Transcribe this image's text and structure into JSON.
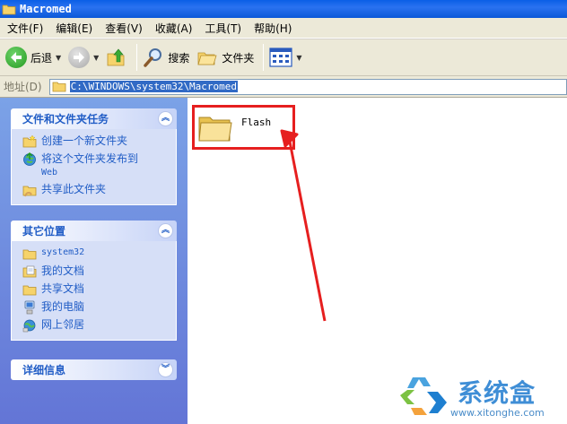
{
  "window": {
    "title": "Macromed"
  },
  "menu": [
    {
      "label": "文件(F)"
    },
    {
      "label": "编辑(E)"
    },
    {
      "label": "查看(V)"
    },
    {
      "label": "收藏(A)"
    },
    {
      "label": "工具(T)"
    },
    {
      "label": "帮助(H)"
    }
  ],
  "toolbar": {
    "back_label": "后退",
    "search_label": "搜索",
    "folders_label": "文件夹"
  },
  "address": {
    "label": "地址(D)",
    "value": "C:\\WINDOWS\\system32\\Macromed"
  },
  "tasks_panel": {
    "title": "文件和文件夹任务",
    "items": [
      {
        "label": "创建一个新文件夹",
        "icon": "new-folder-icon"
      },
      {
        "label": "将这个文件夹发布到",
        "label_line2": "Web",
        "icon": "publish-web-icon"
      },
      {
        "label": "共享此文件夹",
        "icon": "share-folder-icon"
      }
    ]
  },
  "places_panel": {
    "title": "其它位置",
    "items": [
      {
        "label": "system32",
        "icon": "folder-icon"
      },
      {
        "label": "我的文档",
        "icon": "my-documents-icon"
      },
      {
        "label": "共享文档",
        "icon": "shared-documents-icon"
      },
      {
        "label": "我的电脑",
        "icon": "my-computer-icon"
      },
      {
        "label": "网上邻居",
        "icon": "network-places-icon"
      }
    ]
  },
  "details_panel": {
    "title": "详细信息"
  },
  "files": [
    {
      "name": "Flash",
      "icon": "folder-icon"
    }
  ],
  "watermark": {
    "name": "系统盒",
    "url": "www.xitonghe.com"
  },
  "colors": {
    "annotation": "#e61f1f",
    "panel_link": "#215dc6",
    "titlebar": "#0a5fe6"
  }
}
